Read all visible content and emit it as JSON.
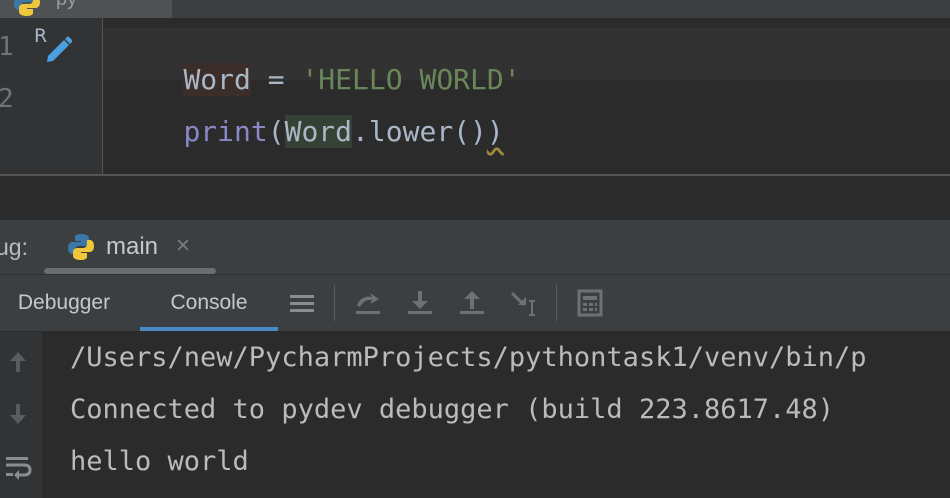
{
  "editor": {
    "tab_name": "py",
    "line_numbers": [
      "1",
      "2"
    ],
    "line1": {
      "var": "Word",
      "op": " = ",
      "string": "'HELLO WORLD'"
    },
    "line2": {
      "func": "print",
      "open": "(",
      "var": "Word",
      "method": ".lower()",
      "close": ")"
    }
  },
  "debug": {
    "label": "ug:",
    "run_tab": {
      "name": "main",
      "close": "×"
    },
    "tabs": {
      "debugger": "Debugger",
      "console": "Console"
    },
    "toolbar_icons": [
      "menu-icon",
      "show-execution-point-icon",
      "step-over-icon",
      "step-into-icon",
      "step-out-icon",
      "run-to-cursor-icon",
      "evaluate-expression-icon"
    ]
  },
  "console": {
    "lines": [
      "/Users/new/PycharmProjects/pythontask1/venv/bin/p",
      "Connected to pydev debugger (build 223.8617.48)",
      "hello world"
    ],
    "gutter_icons": [
      "up-arrow-icon",
      "down-arrow-icon",
      "soft-wrap-icon"
    ]
  },
  "colors": {
    "background": "#2b2b2b",
    "string": "#6a8759",
    "builtin": "#8888c6",
    "text": "#a9b7c6",
    "accent": "#4a88c7"
  }
}
